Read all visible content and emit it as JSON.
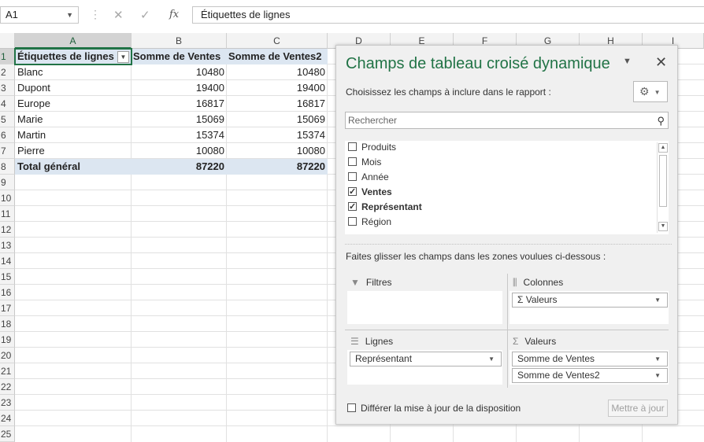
{
  "formula_bar": {
    "name_box": "A1",
    "cancel_icon": "✕",
    "enter_icon": "✓",
    "fx_label": "fx",
    "content": "Étiquettes de lignes"
  },
  "columns": [
    "A",
    "B",
    "C",
    "D",
    "E",
    "F",
    "G",
    "H",
    "I"
  ],
  "rows": [
    "1",
    "2",
    "3",
    "4",
    "5",
    "6",
    "7",
    "8",
    "9",
    "10",
    "11",
    "12",
    "13",
    "14",
    "15",
    "16",
    "17",
    "18",
    "19",
    "20",
    "21",
    "22",
    "23",
    "24",
    "25"
  ],
  "pivot": {
    "headers": [
      "Étiquettes de lignes",
      "Somme de Ventes",
      "Somme de Ventes2"
    ],
    "rows": [
      {
        "label": "Blanc",
        "v1": "10480",
        "v2": "10480"
      },
      {
        "label": "Dupont",
        "v1": "19400",
        "v2": "19400"
      },
      {
        "label": "Europe",
        "v1": "16817",
        "v2": "16817"
      },
      {
        "label": "Marie",
        "v1": "15069",
        "v2": "15069"
      },
      {
        "label": "Martin",
        "v1": "15374",
        "v2": "15374"
      },
      {
        "label": "Pierre",
        "v1": "10080",
        "v2": "10080"
      }
    ],
    "total": {
      "label": "Total général",
      "v1": "87220",
      "v2": "87220"
    }
  },
  "pane": {
    "title": "Champs de tableau croisé dynamique",
    "choose_label": "Choisissez les champs à inclure dans le rapport :",
    "search_placeholder": "Rechercher",
    "fields": [
      {
        "label": "Produits",
        "checked": false
      },
      {
        "label": "Mois",
        "checked": false
      },
      {
        "label": "Année",
        "checked": false
      },
      {
        "label": "Ventes",
        "checked": true
      },
      {
        "label": "Représentant",
        "checked": true
      },
      {
        "label": "Région",
        "checked": false
      }
    ],
    "drag_label": "Faites glisser les champs dans les zones voulues ci-dessous :",
    "zones": {
      "filters": {
        "title": "Filtres",
        "items": []
      },
      "columns": {
        "title": "Colonnes",
        "items": [
          "Σ Valeurs"
        ]
      },
      "rows": {
        "title": "Lignes",
        "items": [
          "Représentant"
        ]
      },
      "values": {
        "title": "Valeurs",
        "items": [
          "Somme de Ventes",
          "Somme de Ventes2"
        ]
      }
    },
    "defer_label": "Différer la mise à jour de la disposition",
    "update_button": "Mettre à jour"
  },
  "colors": {
    "accent": "#217346",
    "header_band": "#dce6f1"
  }
}
